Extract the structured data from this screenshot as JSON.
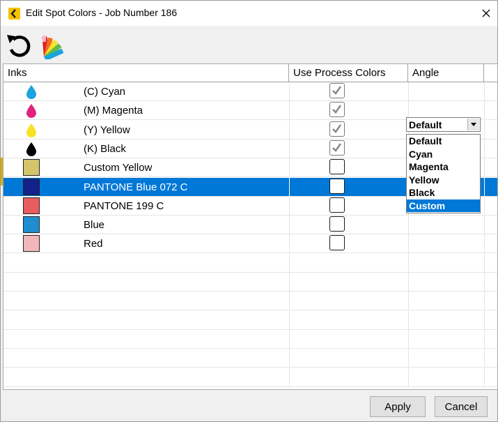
{
  "window": {
    "title": "Edit Spot Colors - Job Number 186",
    "accent_color": "#f5c200"
  },
  "toolbar": {
    "items": [
      {
        "name": "undo-icon"
      },
      {
        "name": "color-swatches-icon"
      }
    ]
  },
  "table": {
    "columns": [
      "Inks",
      "Use Process Colors",
      "Angle"
    ],
    "rows": [
      {
        "name": "(C) Cyan",
        "icon": "drop",
        "color": "#1ba3dd",
        "use_process": true,
        "angle": ""
      },
      {
        "name": "(M) Magenta",
        "icon": "drop",
        "color": "#e2237c",
        "use_process": true,
        "angle": ""
      },
      {
        "name": "(Y) Yellow",
        "icon": "drop",
        "color": "#f7e325",
        "use_process": true,
        "angle": ""
      },
      {
        "name": "(K) Black",
        "icon": "drop",
        "color": "#000000",
        "use_process": true,
        "angle": ""
      },
      {
        "name": "Custom Yellow",
        "icon": "swatch",
        "color": "#d4c46a",
        "use_process": false,
        "angle": "Default"
      },
      {
        "name": "PANTONE Blue 072 C",
        "icon": "swatch",
        "color": "#13218a",
        "use_process": false,
        "angle": "",
        "selected": true
      },
      {
        "name": "PANTONE 199 C",
        "icon": "swatch",
        "color": "#e85d62",
        "use_process": false,
        "angle": ""
      },
      {
        "name": "Blue",
        "icon": "swatch",
        "color": "#1f8ed0",
        "use_process": false,
        "angle": ""
      },
      {
        "name": "Red",
        "icon": "swatch",
        "color": "#f1b8bb",
        "use_process": false,
        "angle": ""
      }
    ]
  },
  "angle_combo": {
    "value": "Default",
    "options": [
      "Default",
      "Cyan",
      "Magenta",
      "Yellow",
      "Black",
      "Custom"
    ],
    "highlighted": "Custom"
  },
  "footer": {
    "apply_label": "Apply",
    "cancel_label": "Cancel"
  }
}
